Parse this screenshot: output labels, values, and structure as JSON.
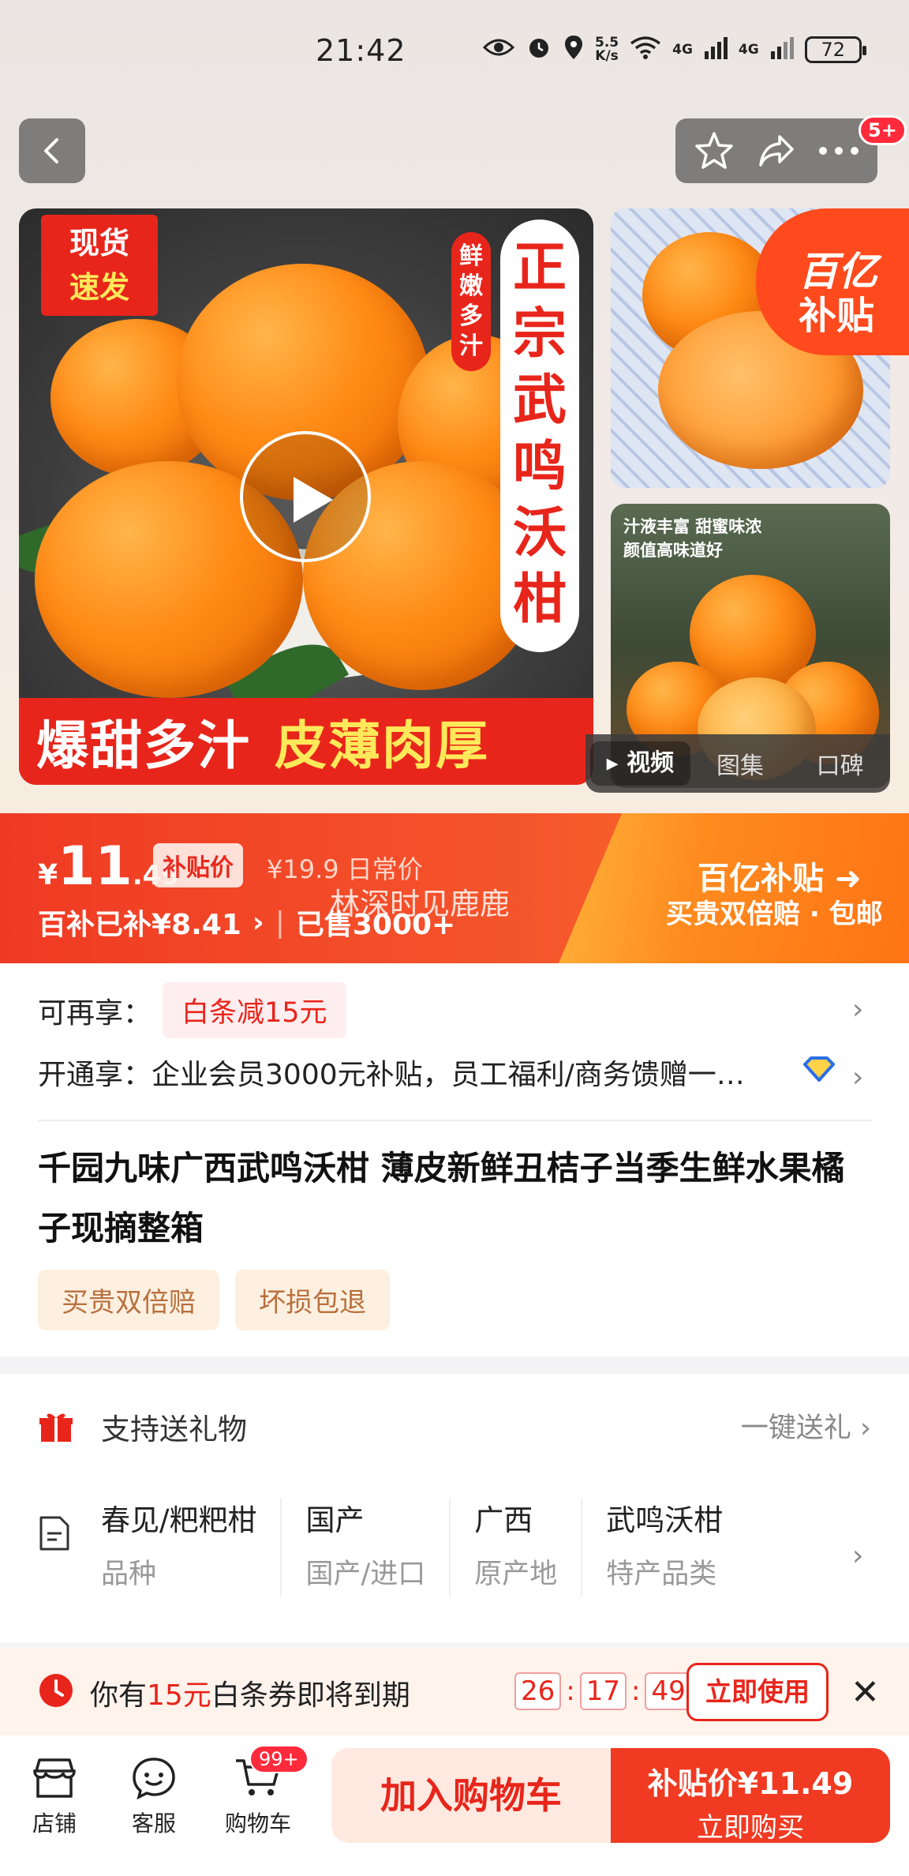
{
  "status_bar": {
    "time": "21:42",
    "net_speed_top": "5.5",
    "net_speed_bottom": "K/s",
    "signal1": "4G",
    "signal2": "4G",
    "battery": "72"
  },
  "nav": {
    "badge": "5+"
  },
  "gallery": {
    "main_tag_top": "现货",
    "main_tag_bottom": "速发",
    "title_chars": [
      "正",
      "宗",
      "武",
      "鸣",
      "沃",
      "柑"
    ],
    "sub_chars": [
      "鲜",
      "嫩",
      "多",
      "汁"
    ],
    "banner_white": "爆甜多汁",
    "banner_yellow": "皮薄肉厚",
    "side2_line1": "汁液丰富 甜蜜味浓",
    "side2_line2": "颜值高味道好",
    "corner_l1": "百亿",
    "corner_l2": "补贴",
    "tabs": [
      "视频",
      "图集",
      "口碑"
    ]
  },
  "price": {
    "yen": "¥",
    "int": "11",
    "dec": ".49",
    "tag": "补贴价",
    "original": "¥19.9 日常价",
    "watermark": "林深时见鹿鹿",
    "subsidy": "百补已补¥8.41",
    "sold": "已售3000+",
    "right_l1": "百亿补贴",
    "right_l2": "买贵双倍赔 · 包邮"
  },
  "info": {
    "row1_label": "可再享：",
    "row1_tag": "白条减15元",
    "row2_label": "开通享：",
    "row2_text": "企业会员3000元补贴，员工福利/商务馈赠一…",
    "title": "千园九味广西武鸣沃柑 薄皮新鲜丑桔子当季生鲜水果橘子现摘整箱",
    "tags": [
      "买贵双倍赔",
      "坏损包退"
    ]
  },
  "spec": {
    "gift_label": "支持送礼物",
    "gift_action": "一键送礼",
    "items": [
      {
        "value": "春见/粑粑柑",
        "key": "品种"
      },
      {
        "value": "国产",
        "key": "国产/进口"
      },
      {
        "value": "广西",
        "key": "原产地"
      },
      {
        "value": "武鸣沃柑",
        "key": "特产品类"
      }
    ]
  },
  "coupon": {
    "text_pre": "你有",
    "text_amount": "15元",
    "text_post": "白条券即将到期",
    "h": "26",
    "m": "17",
    "s": "49",
    "button": "立即使用"
  },
  "bottom": {
    "shop": "店铺",
    "service": "客服",
    "cart": "购物车",
    "cart_badge": "99+",
    "add_cart": "加入购物车",
    "buy_l1": "补贴价¥11.49",
    "buy_l2": "立即购买"
  },
  "colors": {
    "accent": "#e8251b",
    "orange": "#ff7414",
    "tag_bg": "#fdf0e1"
  }
}
